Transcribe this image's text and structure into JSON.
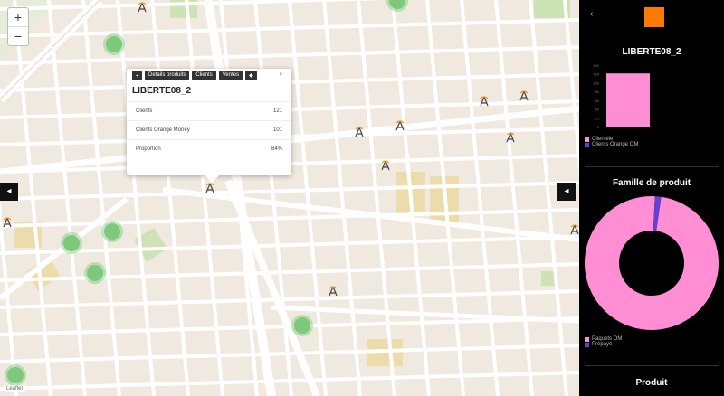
{
  "map": {
    "zoom_in_label": "+",
    "zoom_out_label": "−",
    "attribution": "Leaflet",
    "popup": {
      "tabs": [
        "Details produits",
        "Clients",
        "Ventes",
        "◆"
      ],
      "title": "LIBERTE08_2",
      "rows": [
        {
          "label": "Clients",
          "value": "121"
        },
        {
          "label": "Clients Orange Money",
          "value": "101"
        },
        {
          "label": "Proportion",
          "value": "84%"
        }
      ],
      "close": "×",
      "back": "◂"
    },
    "collapse_left": "◂",
    "expand_right": "◂"
  },
  "sidebar": {
    "back": "‹",
    "site_title": "LIBERTE08_2",
    "bar_chart": {
      "legend": [
        "Clientèle",
        "Clients Orange OM"
      ],
      "colors": {
        "primary": "#ff8ed4",
        "secondary": "#6a3fd0"
      }
    },
    "section_famille": "Famille de produit",
    "donut": {
      "legend": [
        "Paquets OM",
        "Prépayé"
      ],
      "colors": {
        "primary": "#ff8ed4",
        "secondary": "#6a3fd0"
      }
    },
    "section_produit": "Produit"
  },
  "chart_data": [
    {
      "type": "bar",
      "categories": [
        ""
      ],
      "series": [
        {
          "name": "Clientèle",
          "values": [
            121
          ]
        },
        {
          "name": "Clients Orange OM",
          "values": [
            0
          ]
        }
      ],
      "ylim": [
        0,
        140
      ]
    },
    {
      "type": "pie",
      "labels": [
        "Paquets OM",
        "Prépayé"
      ],
      "values": [
        98.5,
        1.5
      ]
    }
  ]
}
